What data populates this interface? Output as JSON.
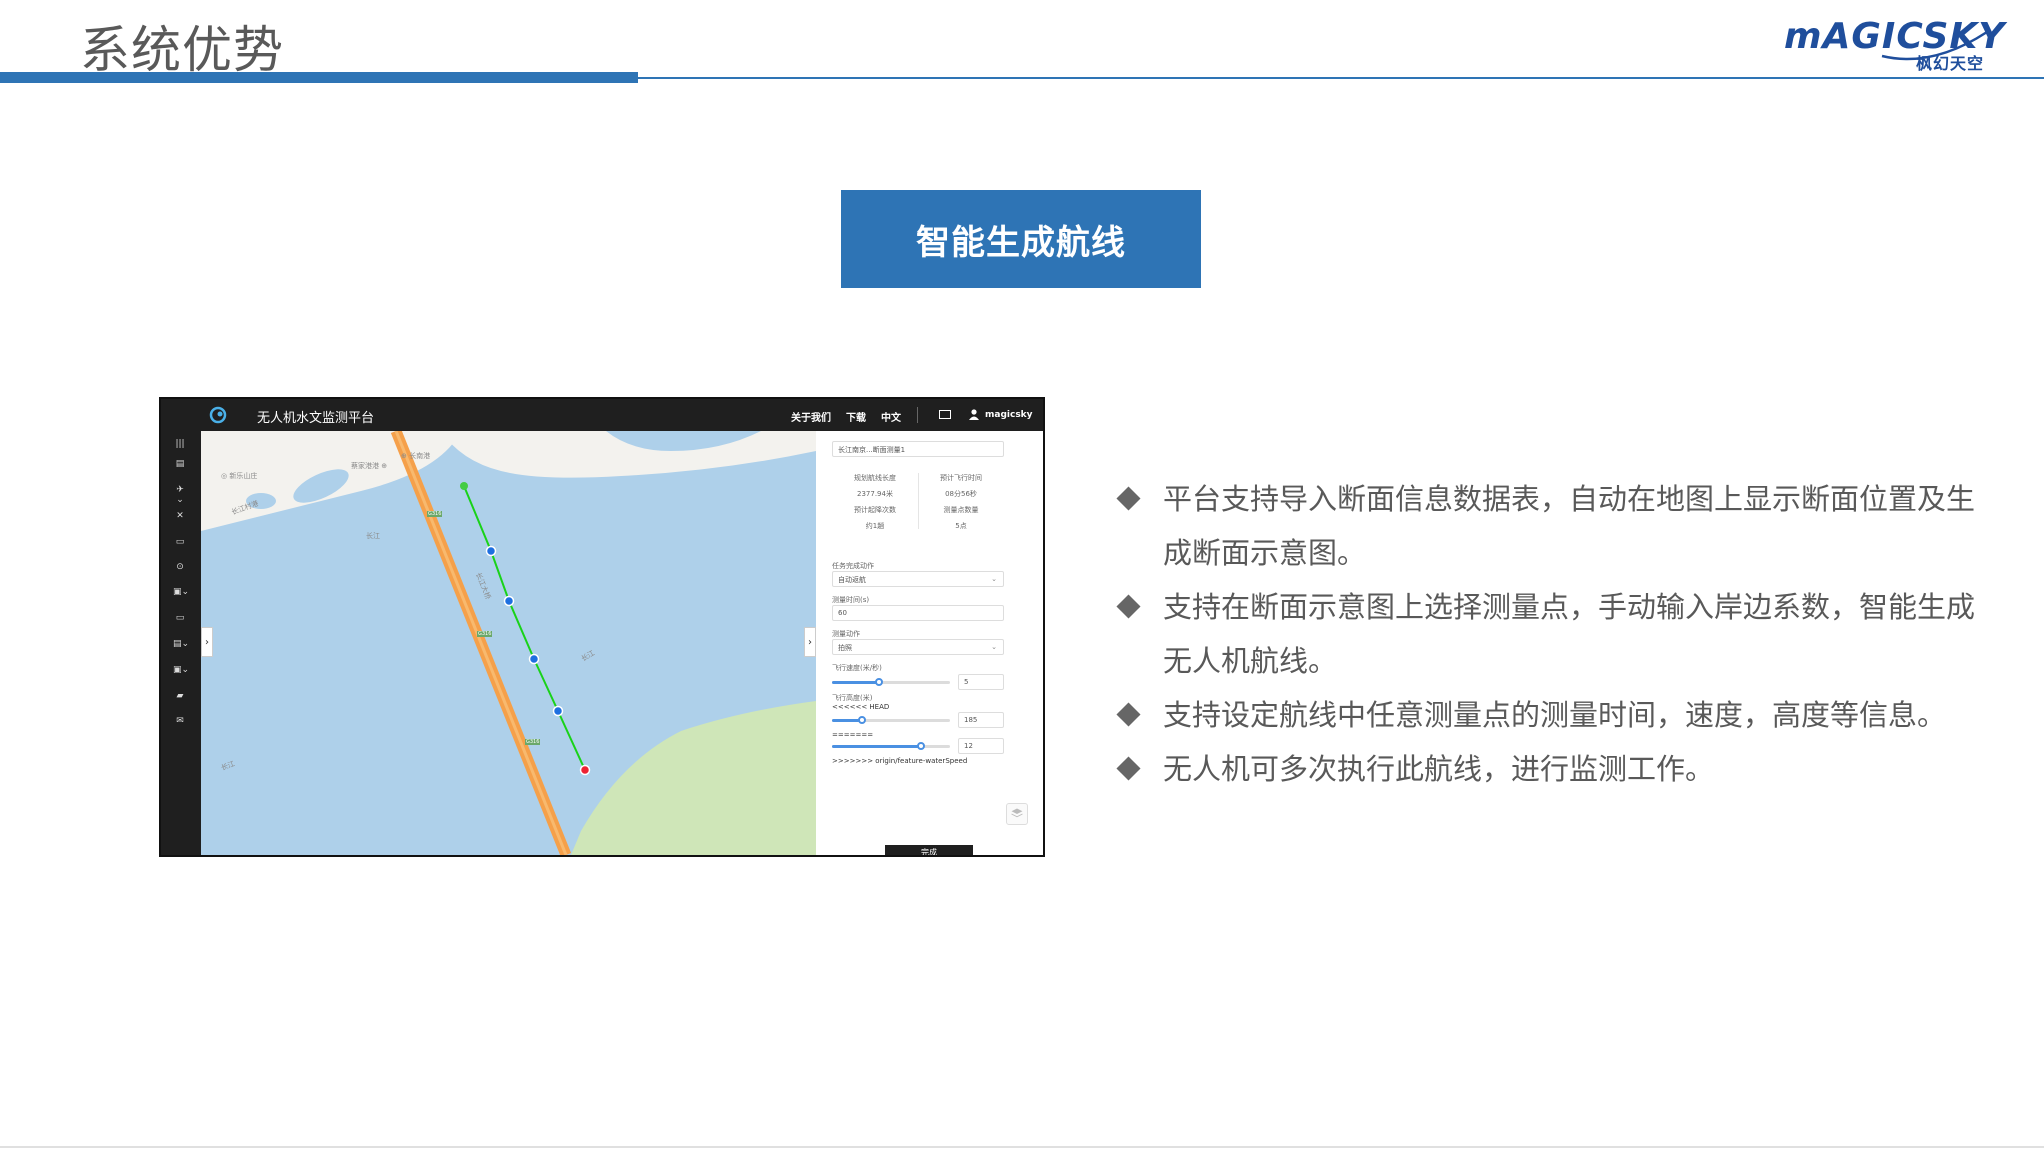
{
  "slide": {
    "title": "系统优势",
    "logo_text": "mAGICSKY",
    "logo_sub": "枫幻天空",
    "section_button": "智能生成航线"
  },
  "app": {
    "title": "无人机水文监测平台",
    "nav": {
      "about": "关于我们",
      "download": "下载",
      "language": "中文"
    },
    "user": "magicsky",
    "sidebar_icons": [
      "menu-icon",
      "map-icon",
      "drone-icon",
      "tools-icon",
      "list-icon",
      "location-icon",
      "task-icon",
      "report-icon",
      "data-icon",
      "archive-icon",
      "chat-icon",
      "mail-icon"
    ],
    "map": {
      "labels": {
        "top_left_1": "◎ 新乐山庄",
        "top_left_2": "长江村港",
        "top_1": "蔡家港港 ⊕",
        "top_2": "⊕ 长南港",
        "river_1": "长江",
        "river_2": "长江",
        "river_3": "长江",
        "road_1": "G316",
        "road_2": "G316",
        "road_3": "G316",
        "bridge": "长江大桥"
      },
      "colors": {
        "water": "#aed0ea",
        "land": "#f3f2ee",
        "road": "#f5a04a",
        "route": "#19d219",
        "waypoint": "#1e6fe0",
        "start": "#44cc44",
        "end": "#ee2233"
      }
    },
    "panel": {
      "section_select": "长江南京...断面测量1",
      "stats": [
        {
          "label": "规划航线长度",
          "value": "2377.94米"
        },
        {
          "label": "预计飞行时间",
          "value": "08分56秒"
        },
        {
          "label": "预计起降次数",
          "value": "约1趟"
        },
        {
          "label": "测量点数量",
          "value": "5点"
        }
      ],
      "mode_label": "任务完成动作",
      "mode_value": "自动返航",
      "hover_label": "测量时间(s)",
      "hover_value": "60",
      "action_label": "测量动作",
      "action_value": "拍照",
      "speed_label": "飞行速度(米/秒)",
      "speed_value": "5",
      "speed_level": 0.4,
      "height_label": "飞行高度(米)",
      "height_note": "<<<<<< HEAD",
      "height_value": "185",
      "height_level": 0.25,
      "divider_text": "=======",
      "extra_value": "12",
      "extra_level": 0.75,
      "footer_note": ">>>>>>> origin/feature-waterSpeed",
      "submit": "完成"
    }
  },
  "bullets": [
    "平台支持导入断面信息数据表，自动在地图上显示断面位置及生成断面示意图。",
    "支持在断面示意图上选择测量点，手动输入岸边系数，智能生成无人机航线。",
    "支持设定航线中任意测量点的测量时间，速度，高度等信息。",
    "无人机可多次执行此航线，进行监测工作。"
  ]
}
